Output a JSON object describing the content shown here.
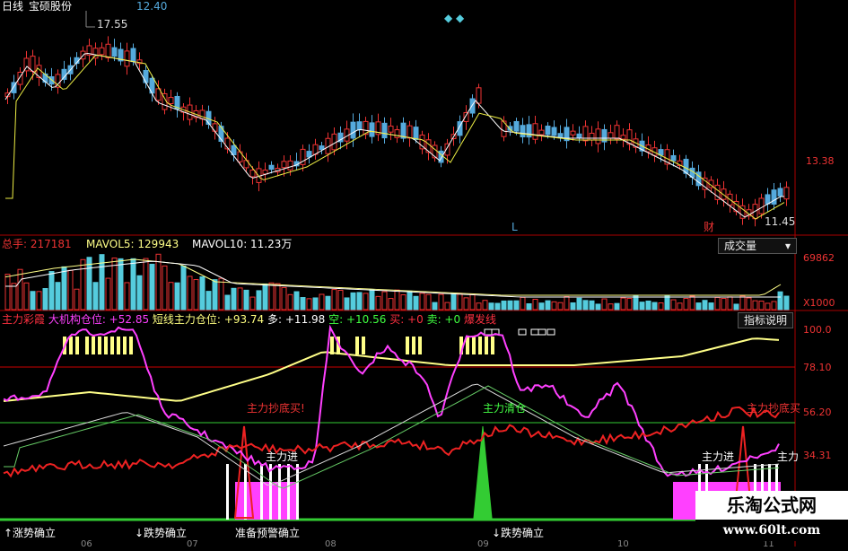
{
  "header": {
    "period": "日线",
    "stock": "宝硕股份",
    "last_price": "12.40"
  },
  "kline": {
    "high_label": "17.55",
    "low_label": "11.45",
    "price_tick": "13.38",
    "marker_l": "L",
    "marker_cai": "财"
  },
  "volume": {
    "total_label": "总手: 217181",
    "mavol5_label": "MAVOL5: 129943",
    "mavol10_label": "MAVOL10: 11.23万",
    "ticks": [
      "69862",
      "X1000"
    ],
    "selector": "成交量"
  },
  "indicator": {
    "legend": [
      {
        "text": "主力彩霞",
        "color": "#ff3040"
      },
      {
        "text": "大机构仓位: +52.85",
        "color": "#ff40ff"
      },
      {
        "text": "短线主力仓位: +93.74",
        "color": "#ffff80"
      },
      {
        "text": "多: +11.98",
        "color": "#ffffff"
      },
      {
        "text": "空: +10.56",
        "color": "#40ff40"
      },
      {
        "text": "买: +0",
        "color": "#ff3040"
      },
      {
        "text": "卖: +0",
        "color": "#40ff40"
      },
      {
        "text": "爆发线",
        "color": "#ff3040"
      }
    ],
    "explain_button": "指标说明",
    "ticks": [
      "100.0",
      "78.10",
      "56.20",
      "34.31"
    ],
    "annotations": [
      "主力抄底买!",
      "主力清仓",
      "主力抄底买",
      "主力进",
      "主力进",
      "主力"
    ],
    "bottom_labels": [
      "↑涨势确立",
      "↓跌势确立",
      "准备预警确立",
      "↓跌势确立"
    ],
    "date_ticks": [
      "06",
      "07",
      "08",
      "09",
      "10",
      "11"
    ]
  },
  "watermark": {
    "title": "乐淘公式网",
    "url": "www.60lt.com"
  }
}
